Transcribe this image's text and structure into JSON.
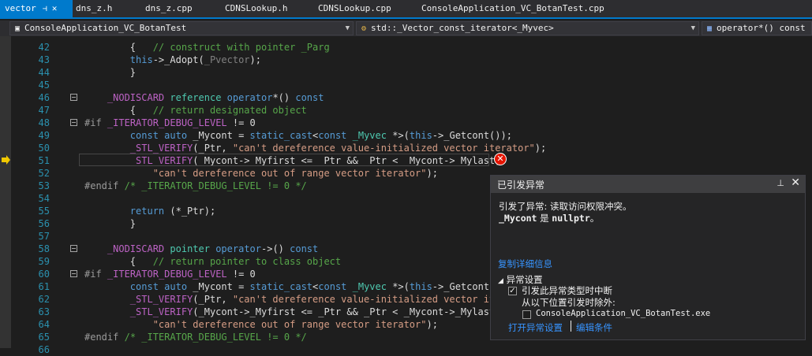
{
  "tabs": [
    {
      "label": "vector",
      "active": true
    },
    {
      "label": "dns_z.h"
    },
    {
      "label": "dns_z.cpp"
    },
    {
      "label": "CDNSLookup.h"
    },
    {
      "label": "CDNSLookup.cpp"
    },
    {
      "label": "ConsoleApplication_VC_BotanTest.cpp"
    }
  ],
  "navbar": {
    "project": "ConsoleApplication_VC_BotanTest",
    "scope": "std::_Vector_const_iterator<_Myvec>",
    "member": "operator*() const"
  },
  "code_lines": [
    {
      "n": "42",
      "html": "        {   <span class=\"cm\">// construct with pointer _Parg</span>"
    },
    {
      "n": "43",
      "html": "        <span class=\"kw\">this</span>-&gt;_Adopt(<span class=\"gr\">_Pvector</span>);"
    },
    {
      "n": "44",
      "html": "        }"
    },
    {
      "n": "45",
      "html": ""
    },
    {
      "n": "46",
      "html": "    <span class=\"mc\">_NODISCARD</span> <span class=\"ty\">reference</span> <span class=\"kw\">operator</span>*() <span class=\"kw\">const</span>"
    },
    {
      "n": "47",
      "html": "        {   <span class=\"cm\">// return designated object</span>"
    },
    {
      "n": "48",
      "html": "<span class=\"pp\">#if</span> <span class=\"mc\">_ITERATOR_DEBUG_LEVEL</span> != 0"
    },
    {
      "n": "49",
      "html": "        <span class=\"kw\">const</span> <span class=\"kw\">auto</span> _Mycont = <span class=\"kw\">static_cast</span>&lt;<span class=\"kw\">const</span> <span class=\"ty\">_Myvec</span> *&gt;(<span class=\"kw\">this</span>-&gt;_Getcont());"
    },
    {
      "n": "50",
      "html": "        <span class=\"mc\">_STL_VERIFY</span>(_Ptr, <span class=\"st\">\"can't dereference value-initialized vector iterator\"</span>);"
    },
    {
      "n": "51",
      "html": "        <span class=\"mc\">_STL_VERIFY</span>(_Mycont-&gt;_Myfirst &lt;= _Ptr &amp;&amp; _Ptr &lt; _Mycont-&gt;_Mylast,"
    },
    {
      "n": "52",
      "html": "            <span class=\"st\">\"can't dereference out of range vector iterator\"</span>);"
    },
    {
      "n": "53",
      "html": "<span class=\"pp\">#endif</span> <span class=\"cm\">/* _ITERATOR_DEBUG_LEVEL != 0 */</span>"
    },
    {
      "n": "54",
      "html": ""
    },
    {
      "n": "55",
      "html": "        <span class=\"kw\">return</span> (*_Ptr);"
    },
    {
      "n": "56",
      "html": "        }"
    },
    {
      "n": "57",
      "html": ""
    },
    {
      "n": "58",
      "html": "    <span class=\"mc\">_NODISCARD</span> <span class=\"ty\">pointer</span> <span class=\"kw\">operator</span>-&gt;() <span class=\"kw\">const</span>"
    },
    {
      "n": "59",
      "html": "        {   <span class=\"cm\">// return pointer to class object</span>"
    },
    {
      "n": "60",
      "html": "<span class=\"pp\">#if</span> <span class=\"mc\">_ITERATOR_DEBUG_LEVEL</span> != 0"
    },
    {
      "n": "61",
      "html": "        <span class=\"kw\">const</span> <span class=\"kw\">auto</span> _Mycont = <span class=\"kw\">static_cast</span>&lt;<span class=\"kw\">const</span> <span class=\"ty\">_Myvec</span> *&gt;(<span class=\"kw\">this</span>-&gt;_Getcont())"
    },
    {
      "n": "62",
      "html": "        <span class=\"mc\">_STL_VERIFY</span>(_Ptr, <span class=\"st\">\"can't dereference value-initialized vector iter</span>"
    },
    {
      "n": "63",
      "html": "        <span class=\"mc\">_STL_VERIFY</span>(_Mycont-&gt;_Myfirst &lt;= _Ptr &amp;&amp; _Ptr &lt; _Mycont-&gt;_Mylast,"
    },
    {
      "n": "64",
      "html": "            <span class=\"st\">\"can't dereference out of range vector iterator\"</span>);"
    },
    {
      "n": "65",
      "html": "<span class=\"pp\">#endif</span> <span class=\"cm\">/* _ITERATOR_DEBUG_LEVEL != 0 */</span>"
    },
    {
      "n": "66",
      "html": ""
    }
  ],
  "popup": {
    "title": "已引发异常",
    "message_line1": "引发了异常: 读取访问权限冲突。",
    "message_var": "_Mycont",
    "message_is": " 是 ",
    "message_val": "nullptr",
    "message_end": "。",
    "copy_details": "复制详细信息",
    "settings_header": "异常设置",
    "break_when_thrown": "引发此异常类型时中断",
    "except_from": "从以下位置引发时除外:",
    "module_name": "ConsoleApplication_VC_BotanTest.exe",
    "open_settings": "打开异常设置",
    "edit_conditions": "编辑条件"
  },
  "colors": {
    "accent": "#007acc",
    "error": "#e51400",
    "link": "#3794ff"
  }
}
